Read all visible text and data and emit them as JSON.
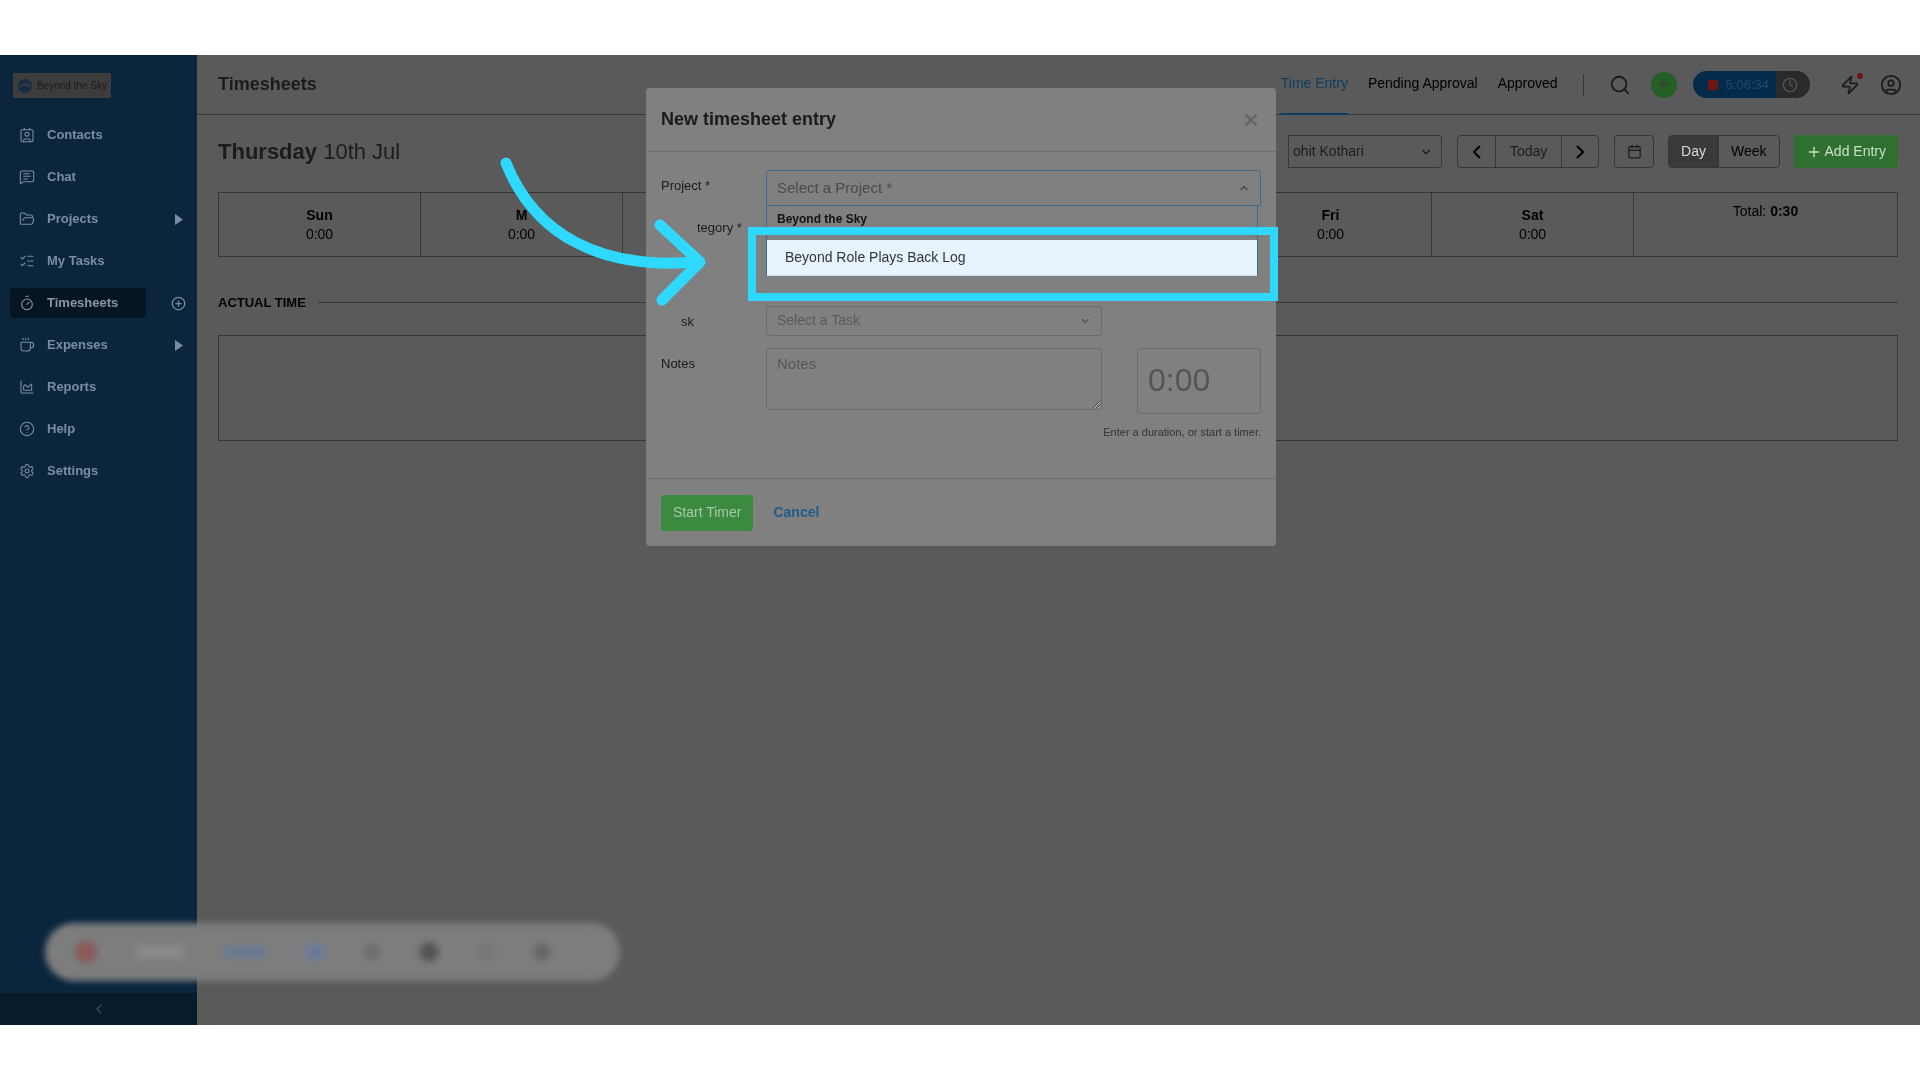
{
  "sidebar": {
    "logo": "Beyond the Sky",
    "items": [
      {
        "label": "Contacts",
        "selected": false,
        "expandable": false,
        "add_button": false
      },
      {
        "label": "Chat",
        "selected": false,
        "expandable": false,
        "add_button": false
      },
      {
        "label": "Projects",
        "selected": false,
        "expandable": true,
        "add_button": false
      },
      {
        "label": "My Tasks",
        "selected": false,
        "expandable": false,
        "add_button": false
      },
      {
        "label": "Timesheets",
        "selected": true,
        "expandable": false,
        "add_button": true
      },
      {
        "label": "Expenses",
        "selected": false,
        "expandable": true,
        "add_button": false
      },
      {
        "label": "Reports",
        "selected": false,
        "expandable": false,
        "add_button": false
      },
      {
        "label": "Help",
        "selected": false,
        "expandable": false,
        "add_button": false
      },
      {
        "label": "Settings",
        "selected": false,
        "expandable": false,
        "add_button": false
      }
    ]
  },
  "header": {
    "title": "Timesheets",
    "tabs": [
      {
        "label": "Time Entry",
        "selected": true
      },
      {
        "label": "Pending Approval",
        "selected": false
      },
      {
        "label": "Approved",
        "selected": false
      }
    ],
    "timer": "5:06:34"
  },
  "content": {
    "day": "Thursday",
    "date": "10th Jul",
    "user_select": "ohit Kothari",
    "today": "Today",
    "views": [
      {
        "label": "Day",
        "selected": true
      },
      {
        "label": "Week",
        "selected": false
      }
    ],
    "add_entry": "Add Entry",
    "days": [
      {
        "name": "Sun",
        "time": "0:00"
      },
      {
        "name": "M",
        "time": "0:00"
      },
      {
        "name": "Fri",
        "time": "0:00"
      },
      {
        "name": "Sat",
        "time": "0:00"
      }
    ],
    "total_label": "Total:",
    "total_value": "0:30",
    "section": "ACTUAL TIME"
  },
  "modal": {
    "title": "New timesheet entry",
    "project_label": "Project *",
    "project_placeholder": "Select a Project *",
    "category_label": "tegory *",
    "task_label": "sk",
    "task_placeholder": "Select a Task",
    "notes_label": "Notes",
    "notes_placeholder": "Notes",
    "duration_placeholder": "0:00",
    "hint": "Enter a duration, or start a timer.",
    "start": "Start Timer",
    "cancel": "Cancel",
    "dropdown": {
      "group": "Beyond the Sky",
      "options": [
        {
          "label": "Beyond Role Plays Back Log",
          "selected": true
        }
      ]
    }
  }
}
